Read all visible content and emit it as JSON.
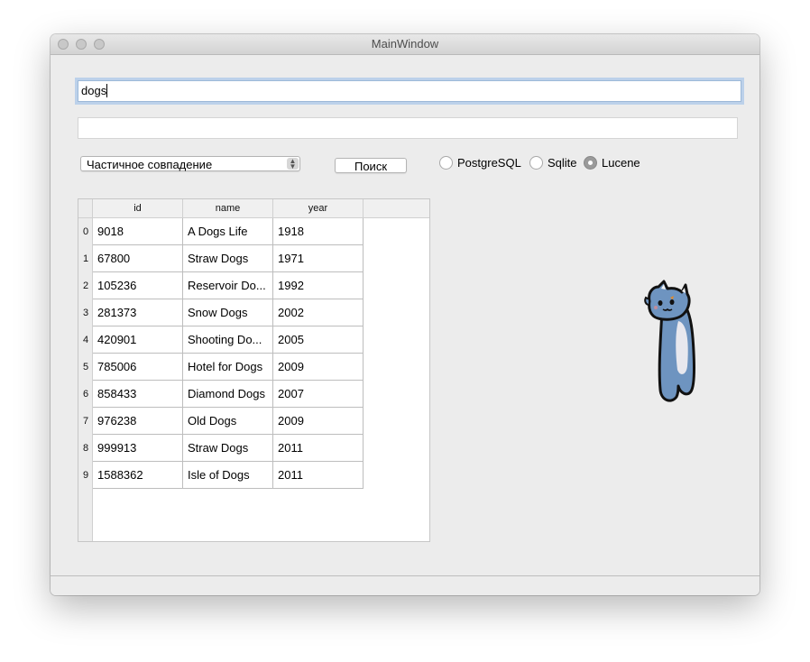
{
  "window": {
    "title": "MainWindow"
  },
  "search": {
    "value": "dogs"
  },
  "result_field": {
    "value": ""
  },
  "match_mode": {
    "selected": "Частичное совпадение"
  },
  "search_button": {
    "label": "Поиск"
  },
  "backends": [
    {
      "label": "PostgreSQL",
      "checked": false
    },
    {
      "label": "Sqlite",
      "checked": false
    },
    {
      "label": "Lucene",
      "checked": true
    }
  ],
  "table": {
    "columns": [
      "id",
      "name",
      "year"
    ],
    "rows": [
      {
        "index": "0",
        "id": "9018",
        "name": "A Dogs Life",
        "year": "1918"
      },
      {
        "index": "1",
        "id": "67800",
        "name": "Straw Dogs",
        "year": "1971"
      },
      {
        "index": "2",
        "id": "105236",
        "name": "Reservoir Do...",
        "year": "1992"
      },
      {
        "index": "3",
        "id": "281373",
        "name": "Snow Dogs",
        "year": "2002"
      },
      {
        "index": "4",
        "id": "420901",
        "name": "Shooting Do...",
        "year": "2005"
      },
      {
        "index": "5",
        "id": "785006",
        "name": "Hotel for Dogs",
        "year": "2009"
      },
      {
        "index": "6",
        "id": "858433",
        "name": "Diamond Dogs",
        "year": "2007"
      },
      {
        "index": "7",
        "id": "976238",
        "name": "Old Dogs",
        "year": "2009"
      },
      {
        "index": "8",
        "id": "999913",
        "name": "Straw Dogs",
        "year": "2011"
      },
      {
        "index": "9",
        "id": "1588362",
        "name": "Isle of Dogs",
        "year": "2011"
      }
    ]
  },
  "colors": {
    "cat_body": "#6e94c0",
    "cat_belly": "#e8e8ee",
    "focus_ring": "#bcd1ea"
  }
}
